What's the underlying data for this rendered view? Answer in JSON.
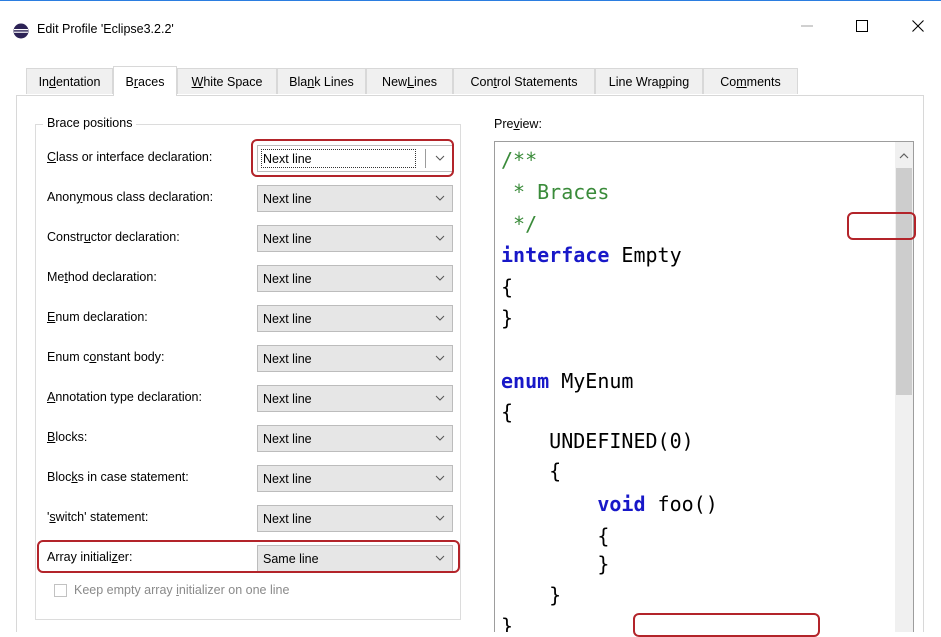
{
  "window": {
    "title": "Edit Profile 'Eclipse3.2.2'",
    "minimize_icon": "minimize-icon",
    "maximize_icon": "maximize-icon",
    "close_icon": "close-icon"
  },
  "tabs": [
    {
      "pre": "In",
      "u": "d",
      "post": "entation"
    },
    {
      "pre": "B",
      "u": "r",
      "post": "aces"
    },
    {
      "pre": "",
      "u": "W",
      "post": "hite Space"
    },
    {
      "pre": "Bla",
      "u": "n",
      "post": "k Lines"
    },
    {
      "pre": "New ",
      "u": "L",
      "post": "ines"
    },
    {
      "pre": "Con",
      "u": "t",
      "post": "rol Statements"
    },
    {
      "pre": "Line Wra",
      "u": "p",
      "post": "ping"
    },
    {
      "pre": "Co",
      "u": "m",
      "post": "ments"
    }
  ],
  "brace_positions": {
    "group_title": "Brace positions",
    "rows": [
      {
        "pre": "",
        "u": "C",
        "post": "lass or interface declaration:",
        "value": "Next line"
      },
      {
        "pre": "Anon",
        "u": "y",
        "post": "mous class declaration:",
        "value": "Next line"
      },
      {
        "pre": "Constr",
        "u": "u",
        "post": "ctor declaration:",
        "value": "Next line"
      },
      {
        "pre": "Me",
        "u": "t",
        "post": "hod declaration:",
        "value": "Next line"
      },
      {
        "pre": "",
        "u": "E",
        "post": "num declaration:",
        "value": "Next line"
      },
      {
        "pre": "Enum c",
        "u": "o",
        "post": "nstant body:",
        "value": "Next line"
      },
      {
        "pre": "",
        "u": "A",
        "post": "nnotation type declaration:",
        "value": "Next line"
      },
      {
        "pre": "",
        "u": "B",
        "post": "locks:",
        "value": "Next line"
      },
      {
        "pre": "Bloc",
        "u": "k",
        "post": "s in case statement:",
        "value": "Next line"
      },
      {
        "pre": "'",
        "u": "s",
        "post": "witch' statement:",
        "value": "Next line"
      },
      {
        "pre": "Array initiali",
        "u": "z",
        "post": "er:",
        "value": "Same line"
      }
    ],
    "checkbox": {
      "pre": "Keep empty array ",
      "u": "i",
      "post": "nitializer on one line",
      "checked": false
    }
  },
  "preview": {
    "label_pre": "Pre",
    "label_u": "v",
    "label_post": "iew:",
    "lines": [
      {
        "t": "c",
        "s": "/**"
      },
      {
        "t": "c",
        "s": " * Braces"
      },
      {
        "t": "c",
        "s": " */"
      },
      {
        "t": "k",
        "k": "interface",
        "s": " Empty"
      },
      {
        "t": "p",
        "s": "{"
      },
      {
        "t": "p",
        "s": "}"
      },
      {
        "t": "p",
        "s": ""
      },
      {
        "t": "k",
        "k": "enum",
        "s": " MyEnum"
      },
      {
        "t": "p",
        "s": "{"
      },
      {
        "t": "p",
        "s": "    UNDEFINED(0)"
      },
      {
        "t": "p",
        "s": "    {"
      },
      {
        "t": "k",
        "pre": "        ",
        "k": "void",
        "s": " foo()"
      },
      {
        "t": "p",
        "s": "        {"
      },
      {
        "t": "p",
        "s": "        }"
      },
      {
        "t": "p",
        "s": "    }"
      },
      {
        "t": "p",
        "s": "}"
      }
    ]
  },
  "colors": {
    "highlight": "#b3242a",
    "keyword": "#1818c8",
    "comment": "#3a8b3a"
  }
}
